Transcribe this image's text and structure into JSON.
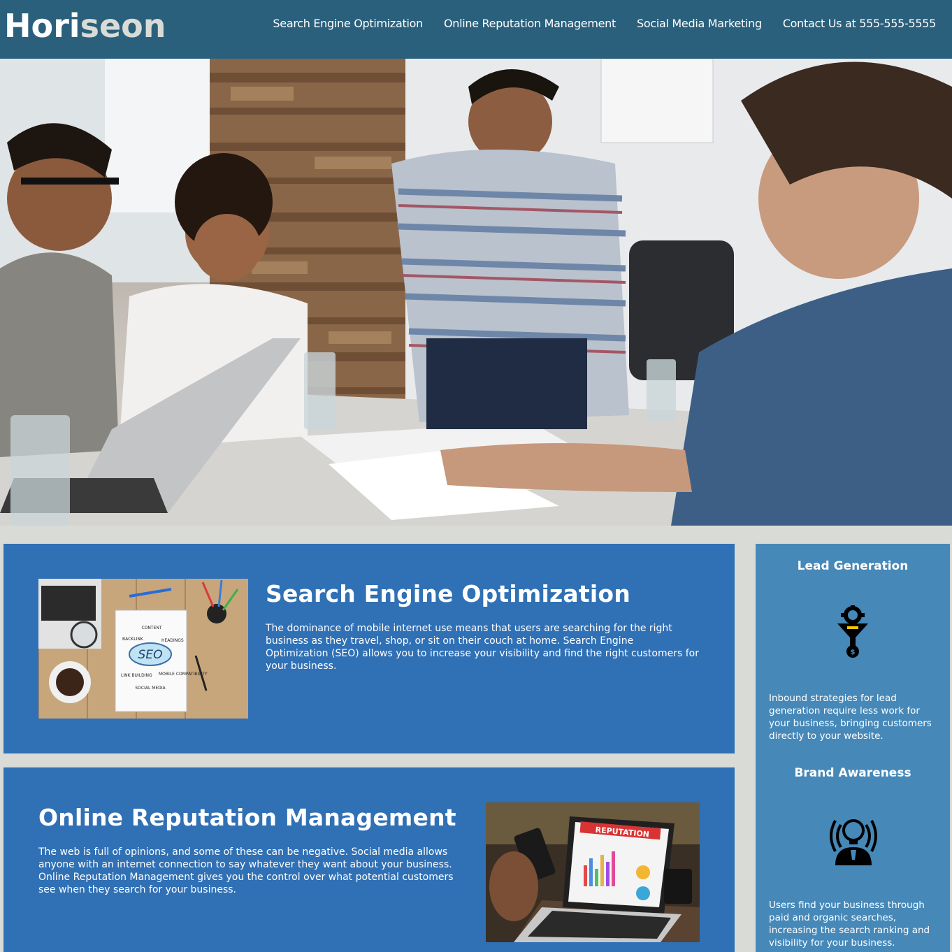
{
  "header": {
    "logo_part1": "Hori",
    "logo_part2": "seon",
    "nav": [
      "Search Engine Optimization",
      "Online Reputation Management",
      "Social Media Marketing",
      "Contact Us at 555-555-5555"
    ]
  },
  "hero": {
    "image": "team-meeting-photo"
  },
  "main": {
    "seo": {
      "title": "Search Engine Optimization",
      "body": "The dominance of mobile internet use means that users are searching for the right business as they travel, shop, or sit on their couch at home. Search Engine Optimization (SEO) allows you to increase your visibility and find the right customers for your business.",
      "image_label": "SEO",
      "image_words": [
        "CONTENT",
        "BACKLINK",
        "HEADINGS",
        "LINK BUILDING",
        "MOBILE COMPATIBILITY",
        "SOCIAL MEDIA"
      ]
    },
    "orm": {
      "title": "Online Reputation Management",
      "body": "The web is full of opinions, and some of these can be negative. Social media allows anyone with an internet connection to say whatever they want about your business. Online Reputation Management gives you the control over what potential customers see when they search for your business.",
      "image_label": "REPUTATION"
    }
  },
  "sidebar": {
    "lead": {
      "title": "Lead Generation",
      "body": "Inbound strategies for lead generation require less work for your business, bringing customers directly to your website."
    },
    "brand": {
      "title": "Brand Awareness",
      "body": "Users find your business through paid and organic searches, increasing the search ranking and visibility for your business."
    }
  },
  "colors": {
    "header_bg": "#2a607c",
    "page_bg": "#d9dcd6",
    "card_bg": "#3070b5",
    "sidebar_bg": "#4688b8"
  }
}
